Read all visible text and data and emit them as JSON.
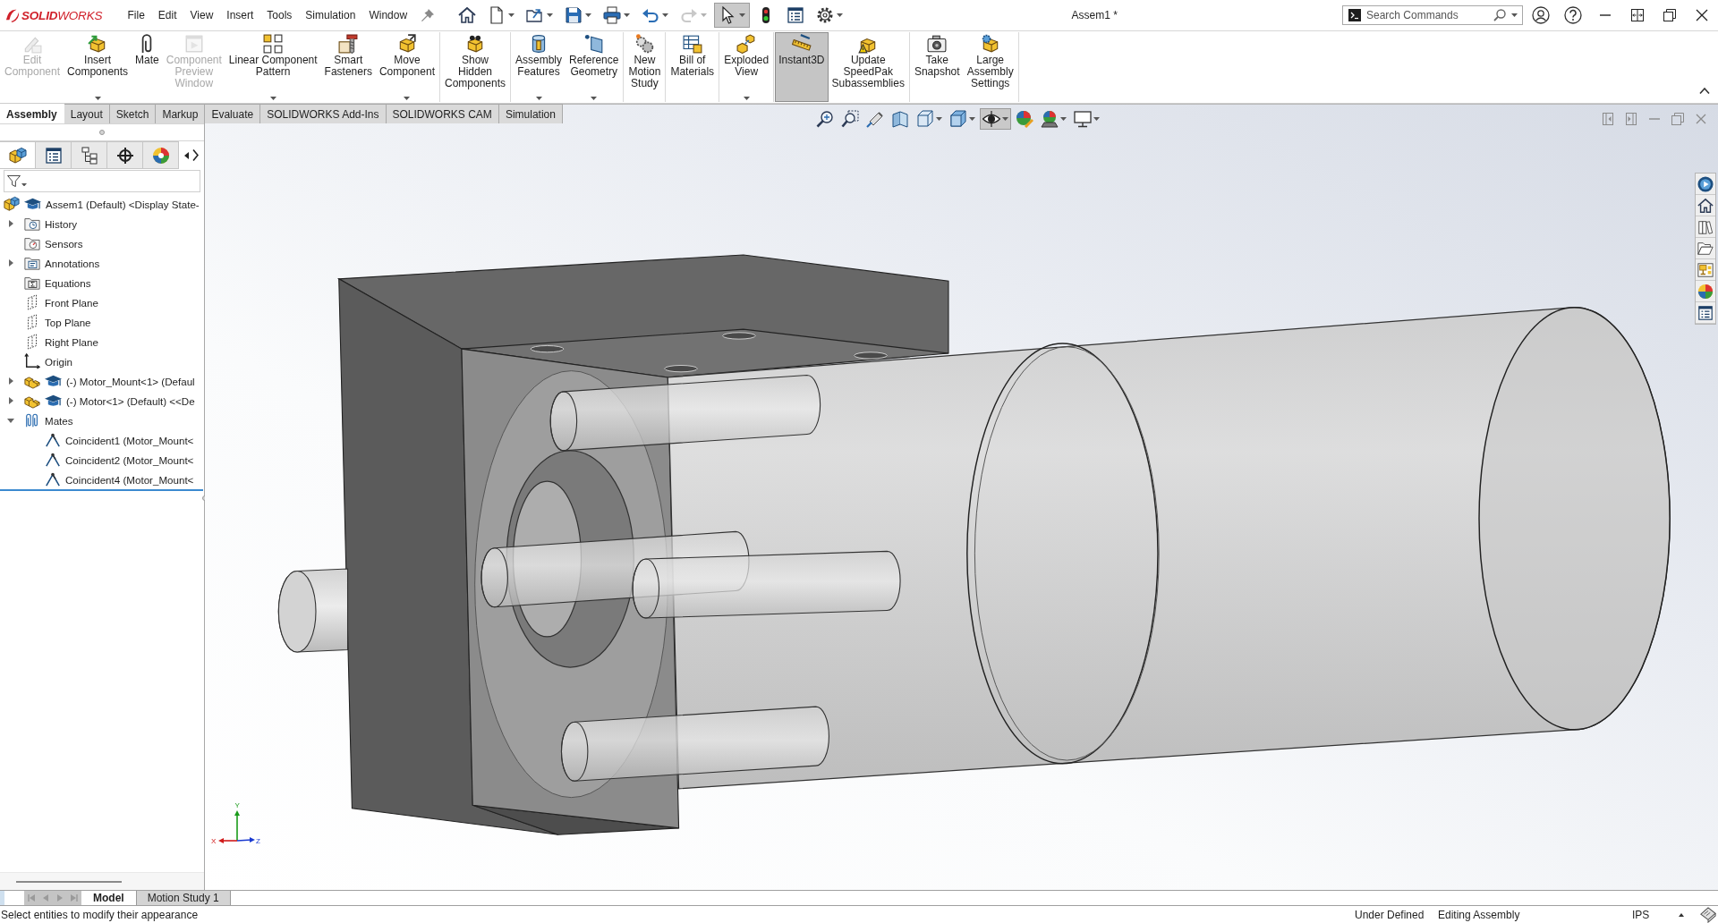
{
  "title_bar": {
    "app_name": "**SOLID**WORKS",
    "menu": [
      "File",
      "Edit",
      "View",
      "Insert",
      "Tools",
      "Simulation",
      "Window"
    ],
    "quick_access": [
      {
        "kind": "home",
        "dropdown": false,
        "disabled": false,
        "selected": false
      },
      {
        "kind": "new",
        "dropdown": true,
        "disabled": false,
        "selected": false
      },
      {
        "kind": "open",
        "dropdown": true,
        "disabled": false,
        "selected": false
      },
      {
        "kind": "save",
        "dropdown": true,
        "disabled": false,
        "selected": false
      },
      {
        "kind": "print",
        "dropdown": true,
        "disabled": false,
        "selected": false
      },
      {
        "kind": "undo",
        "dropdown": true,
        "disabled": false,
        "selected": false
      },
      {
        "kind": "redo",
        "dropdown": true,
        "disabled": true,
        "selected": false
      },
      {
        "kind": "select",
        "dropdown": true,
        "disabled": false,
        "selected": true
      },
      {
        "kind": "rebuild",
        "dropdown": false,
        "disabled": false,
        "selected": false
      },
      {
        "kind": "file-properties",
        "dropdown": false,
        "disabled": false,
        "selected": false
      },
      {
        "kind": "options",
        "dropdown": true,
        "disabled": false,
        "selected": false
      }
    ],
    "document_title": "Assem1 *",
    "search": {
      "placeholder": "Search Commands"
    }
  },
  "ribbon": {
    "groups": [
      {
        "buttons": [
          {
            "kind": "edit-component",
            "label": "Edit\nComponent",
            "dropdown": false,
            "disabled": true,
            "selected": false
          },
          {
            "kind": "insert-components",
            "label": "Insert\nComponents",
            "dropdown": true,
            "disabled": false,
            "selected": false
          },
          {
            "kind": "mate",
            "label": "Mate",
            "dropdown": false,
            "disabled": false,
            "selected": false
          },
          {
            "kind": "preview-window",
            "label": "Component\nPreview\nWindow",
            "dropdown": false,
            "disabled": true,
            "selected": false
          },
          {
            "kind": "pattern",
            "label": "Linear Component\nPattern",
            "dropdown": true,
            "disabled": false,
            "selected": false
          },
          {
            "kind": "fasteners",
            "label": "Smart\nFasteners",
            "dropdown": false,
            "disabled": false,
            "selected": false
          },
          {
            "kind": "move",
            "label": "Move\nComponent",
            "dropdown": true,
            "disabled": false,
            "selected": false
          }
        ]
      },
      {
        "buttons": [
          {
            "kind": "show-hidden",
            "label": "Show\nHidden\nComponents",
            "dropdown": false,
            "disabled": false,
            "selected": false
          }
        ]
      },
      {
        "buttons": [
          {
            "kind": "features",
            "label": "Assembly\nFeatures",
            "dropdown": true,
            "disabled": false,
            "selected": false
          },
          {
            "kind": "geometry",
            "label": "Reference\nGeometry",
            "dropdown": true,
            "disabled": false,
            "selected": false
          }
        ]
      },
      {
        "buttons": [
          {
            "kind": "motion",
            "label": "New\nMotion\nStudy",
            "dropdown": false,
            "disabled": false,
            "selected": false
          }
        ]
      },
      {
        "buttons": [
          {
            "kind": "bom",
            "label": "Bill of\nMaterials",
            "dropdown": false,
            "disabled": false,
            "selected": false
          }
        ]
      },
      {
        "buttons": [
          {
            "kind": "explode",
            "label": "Exploded\nView",
            "dropdown": true,
            "disabled": false,
            "selected": false
          }
        ]
      },
      {
        "buttons": [
          {
            "kind": "instant3d",
            "label": "Instant3D",
            "dropdown": false,
            "disabled": false,
            "selected": true
          },
          {
            "kind": "speedpak",
            "label": "Update\nSpeedPak\nSubassemblies",
            "dropdown": false,
            "disabled": false,
            "selected": false
          }
        ]
      },
      {
        "buttons": [
          {
            "kind": "snapshot",
            "label": "Take\nSnapshot",
            "dropdown": false,
            "disabled": false,
            "selected": false
          },
          {
            "kind": "large-settings",
            "label": "Large\nAssembly\nSettings",
            "dropdown": false,
            "disabled": false,
            "selected": false
          }
        ]
      }
    ]
  },
  "command_tabs": [
    {
      "label": "Assembly",
      "selected": true
    },
    {
      "label": "Layout",
      "selected": false
    },
    {
      "label": "Sketch",
      "selected": false
    },
    {
      "label": "Markup",
      "selected": false
    },
    {
      "label": "Evaluate",
      "selected": false
    },
    {
      "label": "SOLIDWORKS Add-Ins",
      "selected": false
    },
    {
      "label": "SOLIDWORKS CAM",
      "selected": false
    },
    {
      "label": "Simulation",
      "selected": false
    }
  ],
  "feature_tree": {
    "panel_tabs": [
      {
        "kind": "feature-manager",
        "selected": true
      },
      {
        "kind": "property-manager",
        "selected": false
      },
      {
        "kind": "configuration-manager",
        "selected": false
      },
      {
        "kind": "dimxpert-manager",
        "selected": false
      },
      {
        "kind": "display-manager",
        "selected": false
      }
    ],
    "items": [
      {
        "kind": "assembly",
        "label": "Assem1 (Default) <Display State-",
        "children": [
          {
            "kind": "history",
            "label": "History",
            "expanded": false
          },
          {
            "kind": "sensors",
            "label": "Sensors"
          },
          {
            "kind": "annotations",
            "label": "Annotations",
            "expanded": false
          },
          {
            "kind": "equations",
            "label": "Equations"
          },
          {
            "kind": "plane",
            "label": "Front Plane"
          },
          {
            "kind": "plane",
            "label": "Top Plane"
          },
          {
            "kind": "plane",
            "label": "Right Plane"
          },
          {
            "kind": "origin",
            "label": "Origin"
          },
          {
            "kind": "component",
            "label": "(-) Motor_Mount<1> (Defaul",
            "expanded": false
          },
          {
            "kind": "component",
            "label": "(-) Motor<1> (Default) <<De",
            "expanded": false
          },
          {
            "kind": "mates",
            "label": "Mates",
            "expanded": true,
            "children": [
              {
                "kind": "coincident",
                "label": "Coincident1 (Motor_Mount<"
              },
              {
                "kind": "coincident",
                "label": "Coincident2 (Motor_Mount<"
              },
              {
                "kind": "coincident",
                "label": "Coincident4 (Motor_Mount<"
              }
            ]
          }
        ]
      }
    ]
  },
  "view_toolbar": [
    {
      "kind": "zoom-fit",
      "dropdown": false,
      "selected": false
    },
    {
      "kind": "zoom-area",
      "dropdown": false,
      "selected": false
    },
    {
      "kind": "previous-view",
      "dropdown": false,
      "selected": false
    },
    {
      "kind": "section-view",
      "dropdown": false,
      "selected": false
    },
    {
      "kind": "view-orientation",
      "dropdown": true,
      "selected": false
    },
    {
      "kind": "display-style",
      "dropdown": true,
      "selected": false
    },
    {
      "kind": "hide-show",
      "dropdown": true,
      "selected": true
    },
    {
      "kind": "edit-appearance",
      "dropdown": false,
      "selected": false
    },
    {
      "kind": "apply-scene",
      "dropdown": true,
      "selected": false
    },
    {
      "kind": "view-settings",
      "dropdown": true,
      "selected": false
    }
  ],
  "task_pane": [
    {
      "kind": "resources"
    },
    {
      "kind": "home"
    },
    {
      "kind": "library"
    },
    {
      "kind": "explorer"
    },
    {
      "kind": "palette"
    },
    {
      "kind": "appearances"
    },
    {
      "kind": "custom-properties"
    }
  ],
  "viewport": {
    "triad": {
      "x": "X",
      "y": "Y",
      "z": "Z"
    }
  },
  "bottom_tabs": [
    {
      "label": "Model",
      "selected": true
    },
    {
      "label": "Motion Study 1",
      "selected": false
    }
  ],
  "status_bar": {
    "message": "Select entities to modify their appearance",
    "fields": [
      "Under Defined",
      "Editing Assembly",
      "IPS"
    ]
  }
}
